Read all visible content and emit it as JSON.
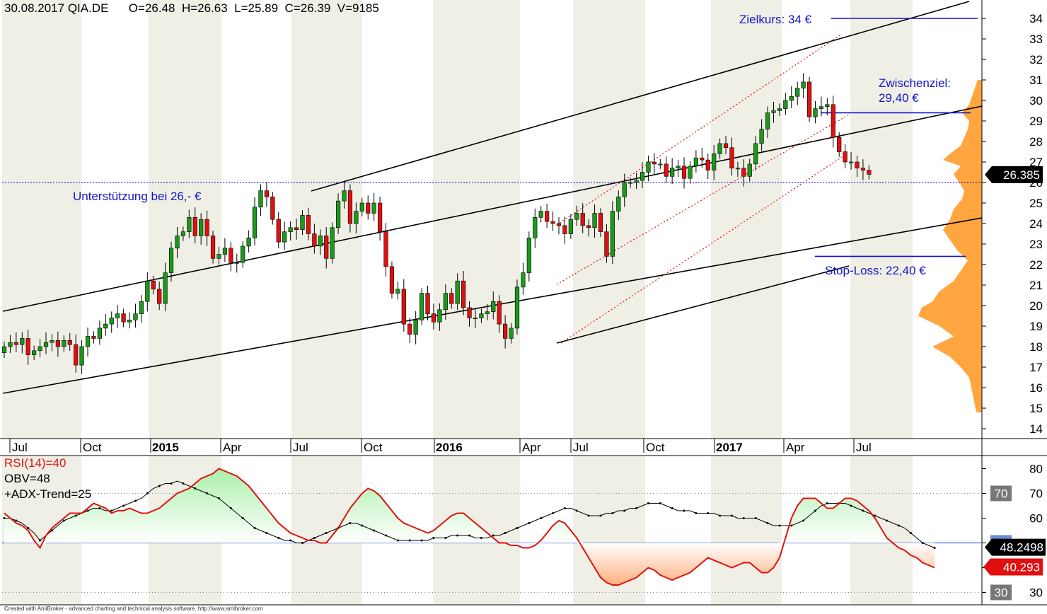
{
  "header": {
    "date": "30.08.2017",
    "symbol": "QIA.DE",
    "open": "O=26.48",
    "high": "H=26.63",
    "low": "L=25.89",
    "close": "C=26.39",
    "volume": "V=9185"
  },
  "footer": "Created with AmiBroker - advanced charting and technical analysis software. http://www.amibroker.com",
  "colors": {
    "candle_up": "#1a9a1a",
    "candle_down": "#e01010",
    "annotation": "#1414c8",
    "support": "#0000cc",
    "volume_profile": "#ffa640",
    "rsi_line": "#e01010",
    "rsi_fill_high": "#aaf0aa",
    "rsi_fill_low": "#ffb080",
    "band_gray": "#efefe6"
  },
  "annotations": {
    "zielkurs": "Zielkurs: 34 €",
    "zwischenziel_1": "Zwischenziel:",
    "zwischenziel_2": "29,40 €",
    "stop_loss": "Stop-Loss: 22,40 €",
    "support": "Unterstützung bei 26,- €",
    "last_price": "26.385"
  },
  "indicators": {
    "rsi_label": "RSI(14)=40",
    "obv_label": "OBV=48",
    "adx_label": "+ADX-Trend=25",
    "obv_value": "48.2498",
    "rsi_value": "40.293",
    "level_70": "70",
    "level_50": "50",
    "level_30": "30"
  },
  "chart_data": [
    {
      "type": "candlestick",
      "symbol": "QIA.DE",
      "period": "weekly",
      "x_ticks": [
        "Jul",
        "Oct",
        "2015",
        "Apr",
        "Jul",
        "Oct",
        "2016",
        "Apr",
        "Jul",
        "Oct",
        "2017",
        "Apr",
        "Jul"
      ],
      "x_ticks_bold": [
        "2015",
        "2016",
        "2017"
      ],
      "y_ticks": [
        14,
        15,
        16,
        17,
        18,
        19,
        20,
        21,
        22,
        23,
        24,
        25,
        26,
        27,
        28,
        29,
        30,
        31,
        32,
        33,
        34
      ],
      "ylim": [
        13.5,
        34.9
      ],
      "grid": false,
      "closes": [
        18.0,
        18.2,
        18.1,
        18.4,
        17.6,
        17.8,
        18.0,
        18.2,
        18.3,
        18.0,
        18.3,
        18.1,
        17.1,
        18.0,
        18.5,
        18.4,
        18.9,
        19.1,
        19.4,
        19.6,
        19.2,
        19.3,
        19.6,
        20.2,
        21.2,
        20.8,
        20.1,
        21.6,
        22.8,
        23.4,
        23.6,
        24.3,
        23.4,
        24.2,
        23.4,
        22.3,
        22.5,
        22.8,
        22.1,
        22.1,
        22.9,
        23.3,
        24.8,
        25.6,
        25.3,
        24.2,
        23.1,
        23.6,
        23.8,
        23.7,
        24.4,
        23.5,
        22.9,
        23.4,
        22.3,
        23.8,
        25.1,
        25.6,
        24.0,
        24.6,
        25.0,
        24.5,
        25.0,
        23.6,
        21.9,
        20.6,
        20.8,
        19.1,
        18.6,
        19.3,
        20.6,
        19.6,
        19.2,
        19.8,
        20.6,
        20.1,
        21.2,
        19.9,
        19.4,
        19.4,
        19.6,
        19.7,
        20.2,
        19.1,
        18.4,
        18.9,
        20.9,
        21.6,
        23.3,
        24.3,
        24.6,
        24.1,
        24.0,
        23.9,
        23.5,
        24.2,
        24.5,
        23.9,
        23.8,
        24.5,
        23.6,
        22.4,
        24.6,
        25.3,
        26.0,
        26.0,
        26.1,
        26.5,
        27.0,
        26.9,
        26.9,
        26.3,
        26.7,
        26.8,
        26.2,
        26.8,
        27.2,
        27.1,
        26.6,
        27.4,
        27.9,
        27.7,
        26.7,
        26.7,
        26.3,
        26.9,
        27.9,
        28.6,
        29.4,
        29.5,
        29.6,
        30.0,
        30.2,
        30.6,
        30.9,
        29.2,
        29.6,
        29.7,
        29.8,
        28.2,
        27.5,
        27.0,
        27.0,
        26.7,
        26.6,
        26.4
      ],
      "last_close": 26.39
    },
    {
      "type": "line",
      "panel": "indicator",
      "ylim": [
        25,
        85
      ],
      "y_ticks": [
        30,
        40,
        50,
        60,
        70,
        80
      ],
      "reference_lines": [
        30,
        50,
        70
      ],
      "series": [
        {
          "name": "RSI(14)",
          "last": 40.293,
          "values": [
            62,
            60,
            58,
            57,
            55,
            51,
            48,
            53,
            56,
            58,
            60,
            62,
            62,
            62,
            64,
            66,
            65,
            64,
            62,
            63,
            63,
            64,
            63,
            62,
            62,
            63,
            64,
            66,
            68,
            70,
            71,
            72,
            74,
            76,
            77,
            78,
            80,
            79,
            78,
            77,
            75,
            73,
            70,
            67,
            64,
            61,
            58,
            56,
            54,
            53,
            52,
            51,
            51,
            50,
            50,
            53,
            56,
            60,
            64,
            67,
            70,
            72,
            71,
            69,
            66,
            63,
            60,
            58,
            57,
            56,
            55,
            54,
            55,
            57,
            59,
            61,
            62,
            62,
            60,
            58,
            56,
            54,
            52,
            50,
            50,
            49,
            49,
            48,
            48,
            49,
            51,
            54,
            57,
            59,
            58,
            55,
            52,
            48,
            44,
            40,
            36,
            34,
            33,
            33,
            34,
            35,
            36,
            38,
            40,
            39,
            37,
            36,
            35,
            36,
            37,
            38,
            40,
            42,
            44,
            43,
            42,
            41,
            40,
            41,
            42,
            42,
            40,
            38,
            38,
            40,
            44,
            52,
            60,
            65,
            68,
            68,
            68,
            66,
            64,
            64,
            66,
            68,
            68,
            67,
            65,
            63,
            60,
            56,
            52,
            50,
            48,
            47,
            45,
            44,
            42,
            41,
            40
          ]
        },
        {
          "name": "OBV",
          "last": 48.2498,
          "values": [
            60,
            60,
            59,
            58,
            56,
            54,
            51,
            53,
            55,
            57,
            59,
            60,
            61,
            62,
            63,
            64,
            64,
            63,
            63,
            64,
            65,
            66,
            67,
            68,
            70,
            72,
            73,
            74,
            74,
            75,
            74,
            73,
            72,
            71,
            70,
            69,
            68,
            66,
            64,
            62,
            60,
            58,
            56,
            55,
            54,
            53,
            52,
            51,
            51,
            50,
            50,
            51,
            52,
            53,
            54,
            55,
            56,
            57,
            58,
            58,
            57,
            56,
            55,
            54,
            53,
            52,
            51,
            51,
            51,
            51,
            51,
            51,
            52,
            52,
            52,
            53,
            53,
            53,
            53,
            52,
            52,
            52,
            53,
            53,
            54,
            55,
            56,
            57,
            58,
            59,
            60,
            61,
            62,
            63,
            64,
            64,
            63,
            62,
            61,
            61,
            61,
            62,
            62,
            63,
            63,
            64,
            64,
            65,
            66,
            66,
            66,
            65,
            64,
            63,
            63,
            63,
            62,
            62,
            62,
            62,
            61,
            61,
            61,
            60,
            60,
            60,
            60,
            59,
            58,
            57,
            57,
            57,
            57,
            58,
            59,
            61,
            63,
            65,
            66,
            66,
            66,
            66,
            65,
            64,
            63,
            62,
            61,
            60,
            59,
            58,
            57,
            56,
            54,
            52,
            50,
            49,
            48
          ]
        },
        {
          "name": "+ADX-Trend",
          "last": 25,
          "values": []
        }
      ]
    }
  ]
}
